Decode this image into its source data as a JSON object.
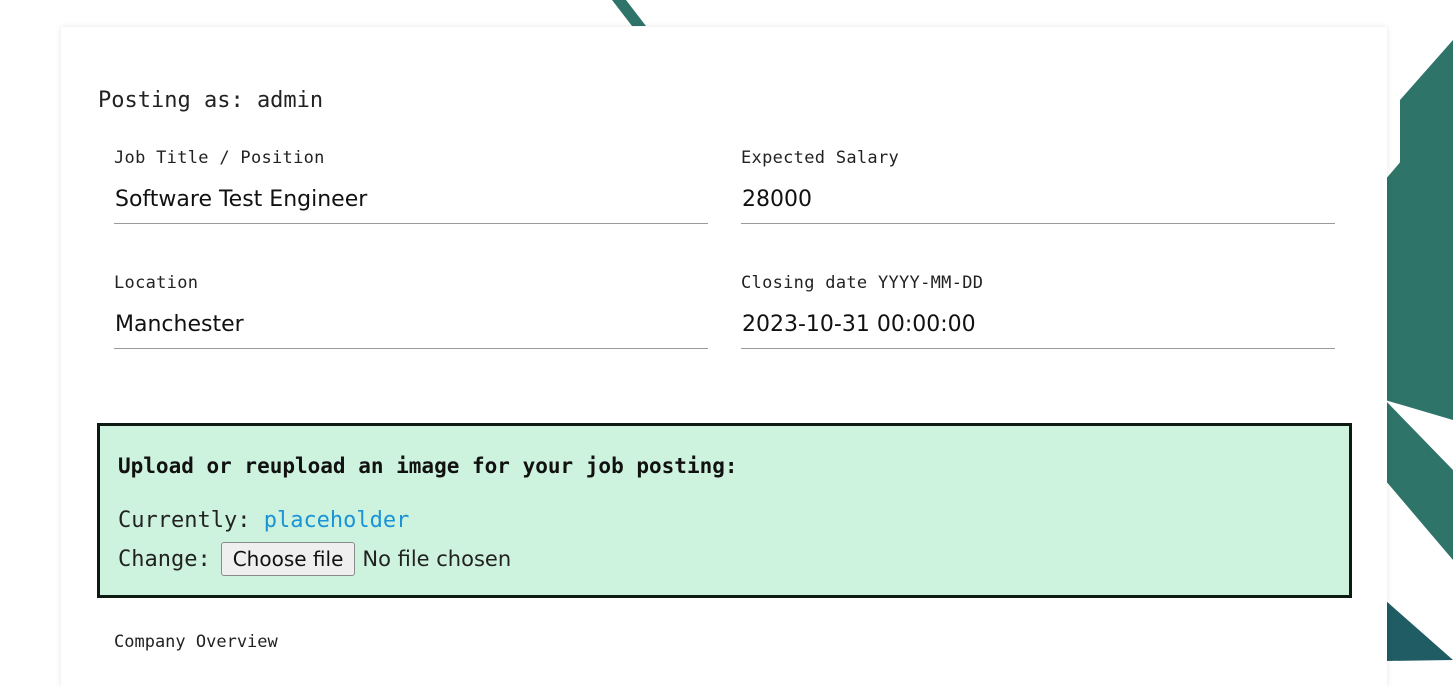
{
  "posting_as": "Posting as: admin",
  "fields": {
    "job_title": {
      "label": "Job Title / Position",
      "value": "Software Test Engineer"
    },
    "salary": {
      "label": "Expected Salary",
      "value": "28000"
    },
    "location": {
      "label": "Location",
      "value": "Manchester"
    },
    "closing_date": {
      "label": "Closing date YYYY-MM-DD",
      "value": "2023-10-31 00:00:00"
    }
  },
  "upload": {
    "title": "Upload or reupload an image for your job posting:",
    "currently_label": "Currently:",
    "currently_link": "placeholder",
    "change_label": "Change:",
    "choose_button": "Choose file",
    "no_file": "No file chosen"
  },
  "company_overview_label": "Company Overview",
  "colors": {
    "stripe": "#2f7469",
    "upload_bg": "#cdf3df",
    "link": "#1a93d6"
  }
}
